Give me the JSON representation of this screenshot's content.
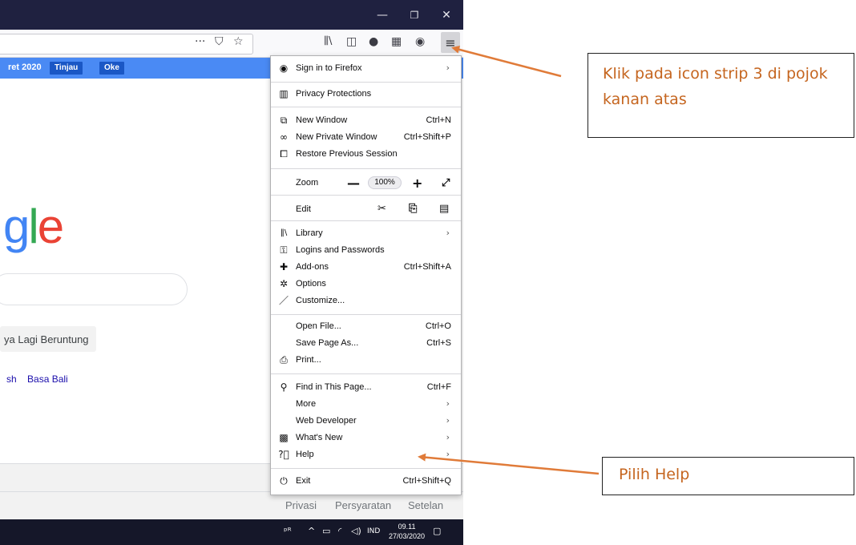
{
  "browser": {
    "window_buttons": {
      "minimize": "—",
      "restore": "❐",
      "close": "✕"
    },
    "notification": {
      "text": "ret 2020",
      "review_button": "Tinjau",
      "ok_button": "Oke"
    }
  },
  "page": {
    "logo_text": {
      "g": "g",
      "l": "l",
      "e": "e"
    },
    "lucky_button": "ya Lagi Beruntung",
    "languages": [
      "sh",
      "Basa Bali"
    ],
    "footer": {
      "privacy": "Privasi",
      "terms": "Persyaratan",
      "settings": "Setelan"
    }
  },
  "menu": {
    "sign_in": "Sign in to Firefox",
    "privacy": "Privacy Protections",
    "new_window": {
      "label": "New Window",
      "shortcut": "Ctrl+N"
    },
    "private_window": {
      "label": "New Private Window",
      "shortcut": "Ctrl+Shift+P"
    },
    "restore_session": "Restore Previous Session",
    "zoom": {
      "label": "Zoom",
      "minus": "—",
      "value": "100%",
      "plus": "+"
    },
    "edit": {
      "label": "Edit"
    },
    "library": "Library",
    "logins": "Logins and Passwords",
    "addons": {
      "label": "Add-ons",
      "shortcut": "Ctrl+Shift+A"
    },
    "options": "Options",
    "customize": "Customize...",
    "open_file": {
      "label": "Open File...",
      "shortcut": "Ctrl+O"
    },
    "save_page": {
      "label": "Save Page As...",
      "shortcut": "Ctrl+S"
    },
    "print": "Print...",
    "find": {
      "label": "Find in This Page...",
      "shortcut": "Ctrl+F"
    },
    "more": "More",
    "web_developer": "Web Developer",
    "whats_new": "What's New",
    "help": "Help",
    "exit": {
      "label": "Exit",
      "shortcut": "Ctrl+Shift+Q"
    }
  },
  "taskbar": {
    "language": "IND",
    "time": "09.11",
    "date": "27/03/2020"
  },
  "annotations": {
    "callout1": "Klik pada icon strip 3 di pojok kanan atas",
    "callout2": "Pilih Help",
    "color": "#e07b39"
  }
}
